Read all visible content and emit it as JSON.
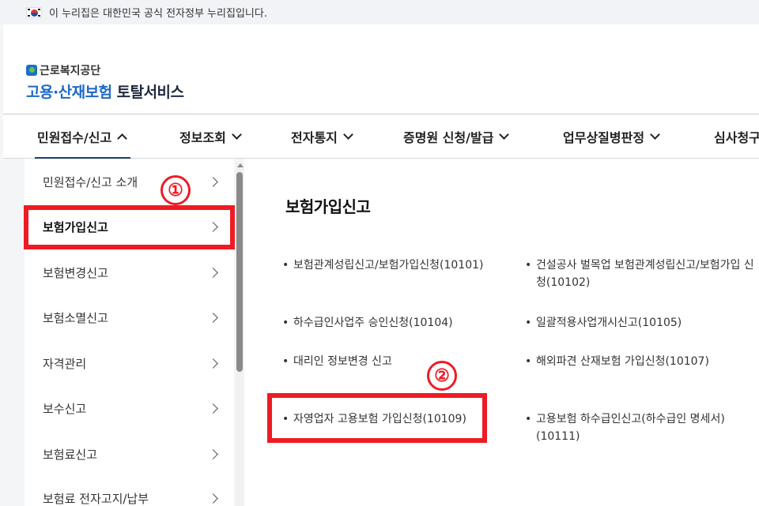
{
  "gov_banner": {
    "text": "이 누리집은 대한민국 공식 전자정부 누리집입니다."
  },
  "logo": {
    "org": "근로복지공단",
    "service_blue": "고용·산재보험",
    "service_dark": "토탈서비스"
  },
  "gnb": [
    {
      "label": "민원접수/신고",
      "expanded": true
    },
    {
      "label": "정보조회",
      "expanded": false
    },
    {
      "label": "전자통지",
      "expanded": false
    },
    {
      "label": "증명원 신청/발급",
      "expanded": false
    },
    {
      "label": "업무상질병판정",
      "expanded": false
    },
    {
      "label": "심사청구",
      "expanded": false
    }
  ],
  "lnb": [
    {
      "label": "민원접수/신고 소개"
    },
    {
      "label": "보험가입신고"
    },
    {
      "label": "보험변경신고"
    },
    {
      "label": "보험소멸신고"
    },
    {
      "label": "자격관리"
    },
    {
      "label": "보수신고"
    },
    {
      "label": "보험료신고"
    },
    {
      "label": "보험료 전자고지/납부"
    }
  ],
  "content": {
    "title": "보험가입신고",
    "links": [
      "보험관계성립신고/보험가입신청(10101)",
      "건설공사 벌목업 보험관계성립신고/보험가입 신청(10102)",
      "하수급인사업주 승인신청(10104)",
      "일괄적용사업개시신고(10105)",
      "대리인 정보변경 신고",
      "해외파견 산재보험 가입신청(10107)",
      "자영업자 고용보험 가입신청(10109)",
      "고용보험 하수급인신고(하수급인 명세서)(10111)"
    ]
  },
  "annotations": {
    "step1": "①",
    "step2": "②"
  },
  "colors": {
    "highlight": "#ee1b24",
    "brand_blue": "#1d68c8",
    "nav_active": "#1d3c6c"
  },
  "icons": {
    "flag": "korea-flag-icon",
    "chevron": "chevron-down-icon",
    "arrow": "chevron-right-icon"
  }
}
